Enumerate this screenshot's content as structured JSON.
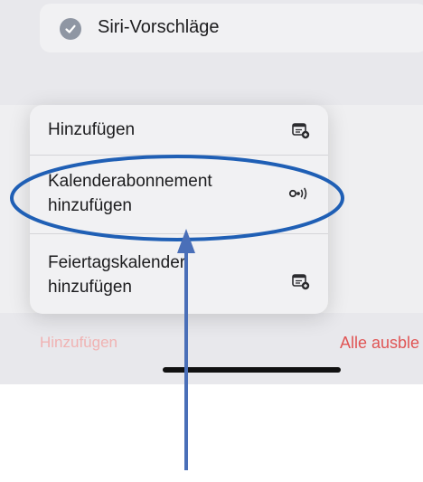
{
  "siri_suggestions": {
    "label": "Siri-Vorschläge",
    "checked": true
  },
  "menu": {
    "items": [
      {
        "label": "Hinzufügen",
        "icon": "calendar-add-icon"
      },
      {
        "label": "Kalenderabonnement\nhinzufügen",
        "icon": "broadcast-icon"
      },
      {
        "label": "Feiertagskalender\nhinzufügen",
        "icon": "calendar-add-icon"
      }
    ]
  },
  "footer": {
    "add_label": "Hinzufügen",
    "hide_all_label": "Alle ausble"
  },
  "colors": {
    "annotation": "#1f5fb5",
    "destructive": "#e05555",
    "disabled_destructive": "#f0b2b2"
  }
}
